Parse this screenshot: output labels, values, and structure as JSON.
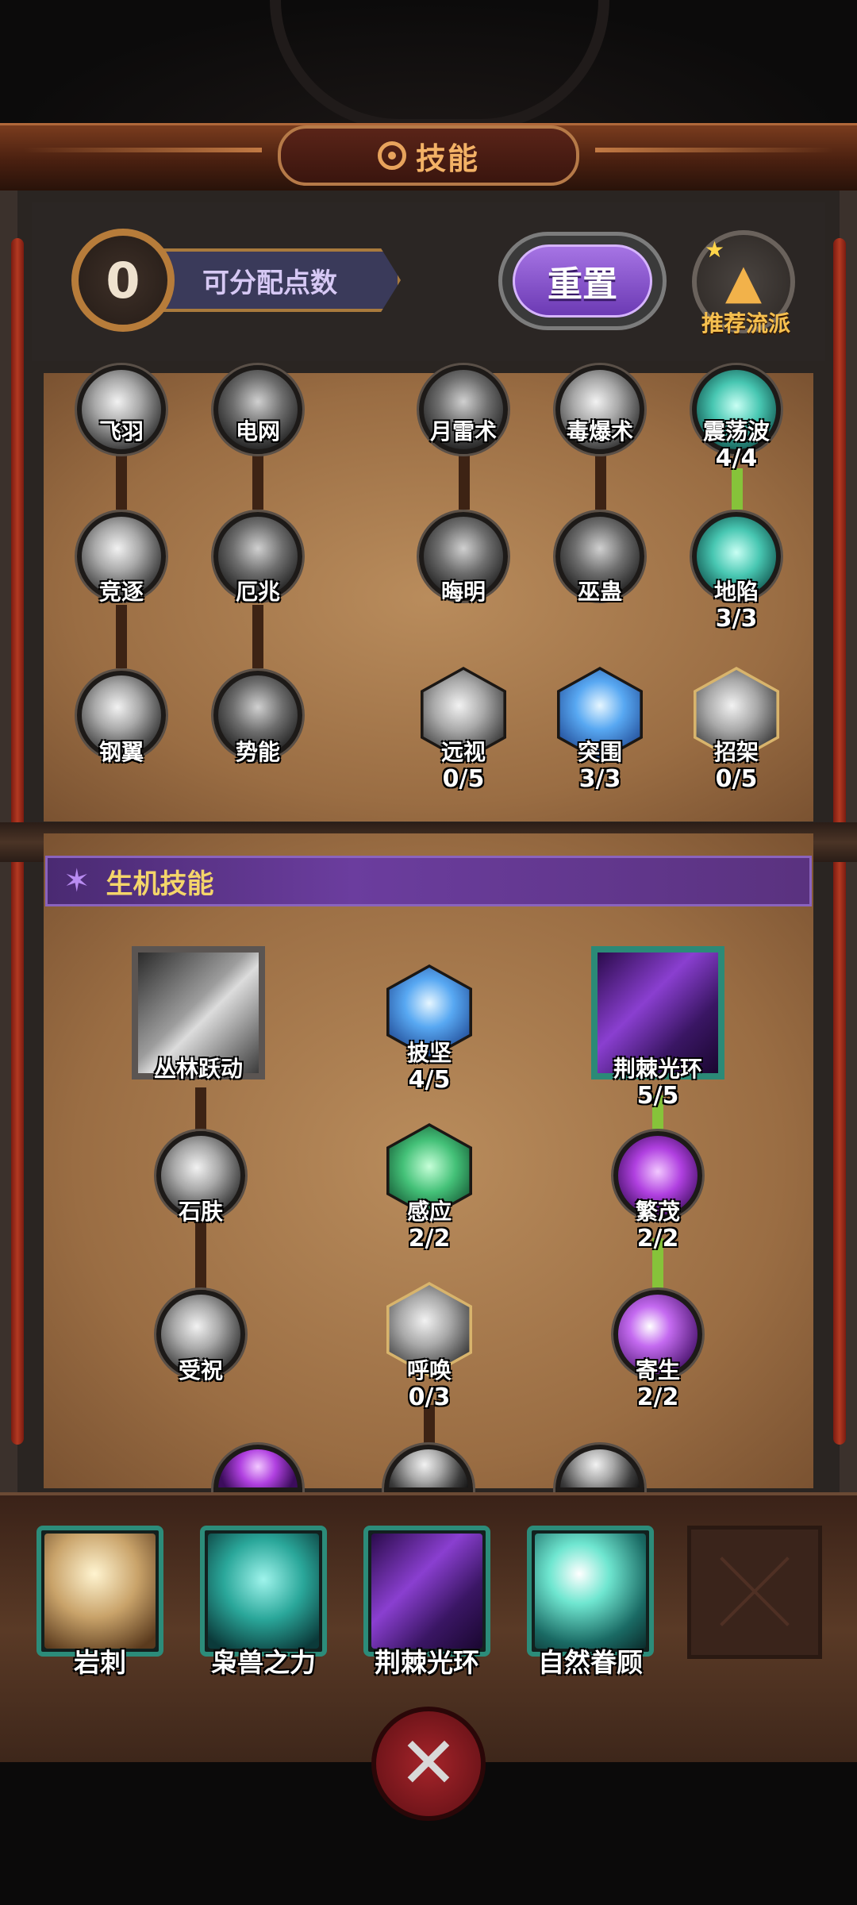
{
  "header": {
    "title": "技能",
    "icon": "gear-icon"
  },
  "points": {
    "value": "0",
    "label": "可分配点数"
  },
  "buttons": {
    "reset": "重置",
    "recommend": "推荐流派"
  },
  "upper_tree": {
    "row1": [
      "飞羽",
      "电网",
      "月雷术",
      "毒爆术",
      "震荡波"
    ],
    "row1_levels": {
      "震荡波": "4/4"
    },
    "row2": [
      "竞逐",
      "厄兆",
      "晦明",
      "巫蛊",
      "地陷"
    ],
    "row2_levels": {
      "地陷": "3/3"
    },
    "row3": [
      "钢翼",
      "势能",
      "远视",
      "突围",
      "招架"
    ],
    "row3_levels": {
      "远视": "0/5",
      "突围": "3/3",
      "招架": "0/5"
    }
  },
  "section": {
    "title": "生机技能"
  },
  "lower_tree": {
    "jungle": "丛林跃动",
    "harden": {
      "label": "披坚",
      "level": "4/5"
    },
    "thorn": {
      "label": "荆棘光环",
      "level": "5/5"
    },
    "stoneskin": "石肤",
    "sense": {
      "label": "感应",
      "level": "2/2"
    },
    "flourish": {
      "label": "繁茂",
      "level": "2/2"
    },
    "blessing": "受祝",
    "summon": {
      "label": "呼唤",
      "level": "0/3"
    },
    "parasite": {
      "label": "寄生",
      "level": "2/2"
    }
  },
  "equipped": [
    "岩刺",
    "枭兽之力",
    "荆棘光环",
    "自然眷顾"
  ],
  "colors": {
    "accent_purple": "#6b3d9e",
    "teal_border": "#2c8c7a",
    "link_green": "#86c33a",
    "title_orange": "#f3b266"
  }
}
